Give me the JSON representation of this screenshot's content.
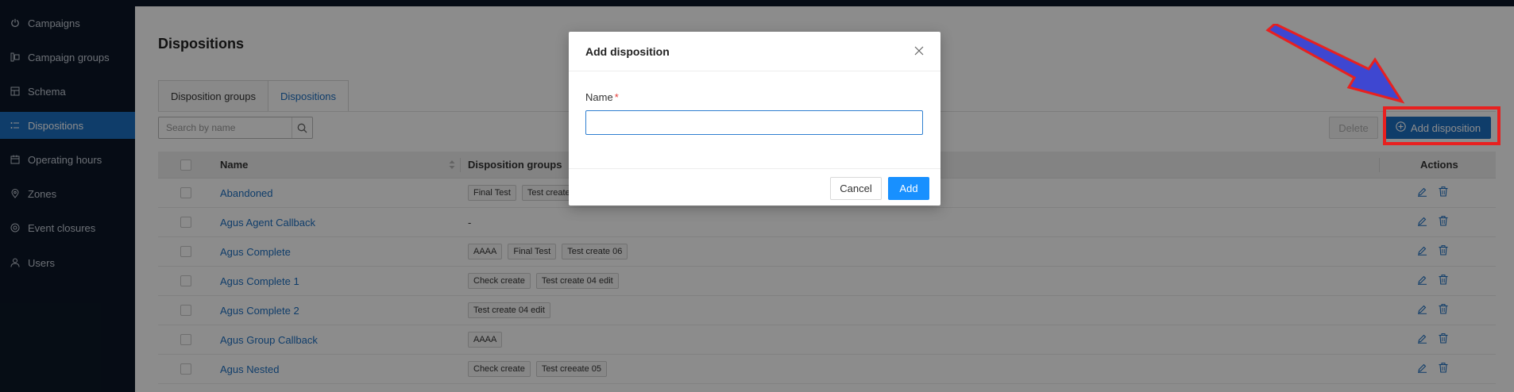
{
  "sidebar": {
    "items": [
      {
        "label": "Campaigns",
        "icon": "power-icon"
      },
      {
        "label": "Campaign groups",
        "icon": "campaign-groups-icon"
      },
      {
        "label": "Schema",
        "icon": "schema-icon"
      },
      {
        "label": "Dispositions",
        "icon": "list-icon",
        "active": true
      },
      {
        "label": "Operating hours",
        "icon": "calendar-icon"
      },
      {
        "label": "Zones",
        "icon": "location-pin-icon"
      },
      {
        "label": "Event closures",
        "icon": "event-icon"
      },
      {
        "label": "Users",
        "icon": "user-icon"
      }
    ]
  },
  "page": {
    "title": "Dispositions",
    "tabs": [
      {
        "label": "Disposition groups",
        "active": false
      },
      {
        "label": "Dispositions",
        "active": true
      }
    ],
    "search_placeholder": "Search by name",
    "delete_label": "Delete",
    "add_label": "Add disposition"
  },
  "table": {
    "headers": {
      "name": "Name",
      "groups": "Disposition groups",
      "actions": "Actions"
    },
    "rows": [
      {
        "name": "Abandoned",
        "groups": [
          "Final Test",
          "Test create"
        ],
        "dash": ""
      },
      {
        "name": "Agus Agent Callback",
        "groups": [],
        "dash": "-"
      },
      {
        "name": "Agus Complete",
        "groups": [
          "AAAA",
          "Final Test",
          "Test create 06"
        ],
        "dash": ""
      },
      {
        "name": "Agus Complete 1",
        "groups": [
          "Check create",
          "Test create 04 edit"
        ],
        "dash": ""
      },
      {
        "name": "Agus Complete 2",
        "groups": [
          "Test create 04 edit"
        ],
        "dash": ""
      },
      {
        "name": "Agus Group Callback",
        "groups": [
          "AAAA"
        ],
        "dash": ""
      },
      {
        "name": "Agus Nested",
        "groups": [
          "Check create",
          "Test creeate 05"
        ],
        "dash": ""
      }
    ]
  },
  "modal": {
    "title": "Add disposition",
    "field_label": "Name",
    "required_mark": "*",
    "field_value": "",
    "cancel_label": "Cancel",
    "add_label": "Add"
  },
  "colors": {
    "sidebar_bg": "#0b1727",
    "accent": "#1d6fc2",
    "primary_button": "#1890ff",
    "annotation_red": "#e8201f",
    "annotation_arrow": "#3e47d1"
  }
}
